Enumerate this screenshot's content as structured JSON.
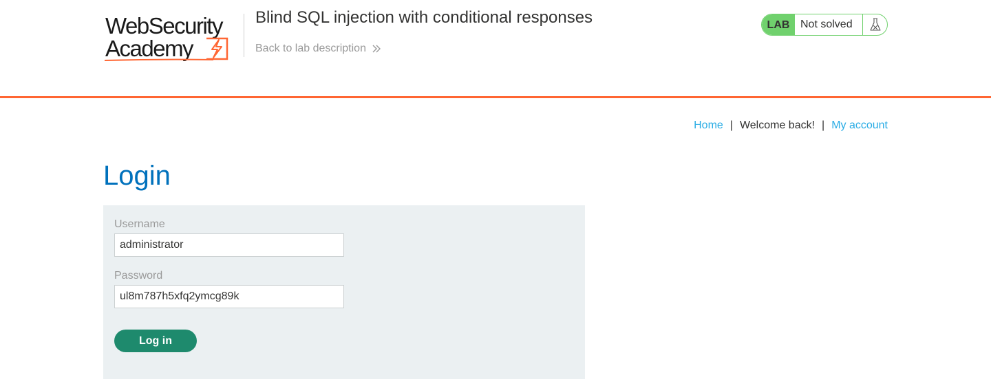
{
  "header": {
    "logo_line1": "WebSecurity",
    "logo_line2": "Academy",
    "lab_title": "Blind SQL injection with conditional responses",
    "back_link": "Back to lab description"
  },
  "lab_status": {
    "badge": "LAB",
    "state": "Not solved",
    "icon": "flask-icon"
  },
  "nav": {
    "home": "Home",
    "separator": "|",
    "welcome": "Welcome back!",
    "my_account": "My account"
  },
  "login": {
    "title": "Login",
    "username_label": "Username",
    "username_value": "administrator",
    "password_label": "Password",
    "password_value": "ul8m787h5xfq2ymcg89k",
    "submit_label": "Log in"
  },
  "colors": {
    "accent_orange": "#ff6633",
    "link_blue": "#29ace5",
    "title_blue": "#0071bc",
    "lab_green": "#70d16d",
    "button_green": "#1e8a6d",
    "panel_bg": "#ebf0f2"
  }
}
